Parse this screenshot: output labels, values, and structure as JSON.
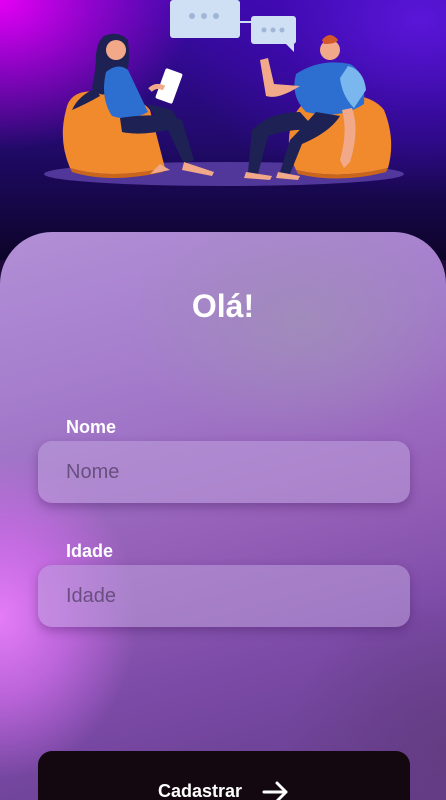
{
  "hero": {
    "illustration": "two-people-chatting-on-beanbags"
  },
  "form": {
    "greeting": "Olá!",
    "name_label": "Nome",
    "name_placeholder": "Nome",
    "age_label": "Idade",
    "age_placeholder": "Idade",
    "submit_label": "Cadastrar",
    "submit_icon": "arrow-right-icon"
  },
  "colors": {
    "accent_magenta": "#e400f4",
    "deep_purple": "#210a6a",
    "beanbag_orange": "#f08a2c",
    "button_dark": "#13080f"
  }
}
